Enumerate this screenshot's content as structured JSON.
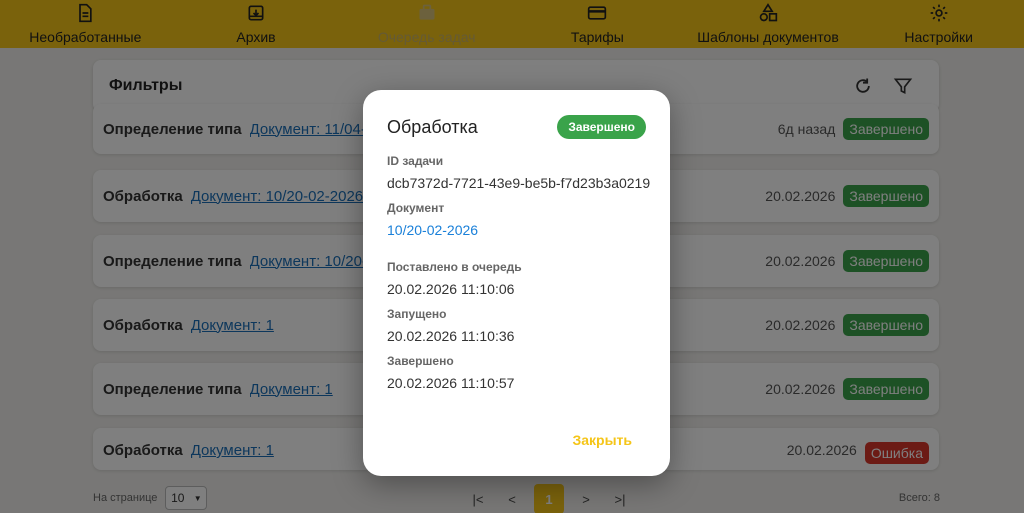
{
  "nav": {
    "items": [
      {
        "label": "Необработанные",
        "icon": "document-icon"
      },
      {
        "label": "Архив",
        "icon": "archive-icon"
      },
      {
        "label": "Очередь задач",
        "icon": "briefcase-icon"
      },
      {
        "label": "Тарифы",
        "icon": "credit-card-icon"
      },
      {
        "label": "Шаблоны документов",
        "icon": "shapes-icon"
      },
      {
        "label": "Настройки",
        "icon": "gear-icon"
      }
    ],
    "active_index": 2,
    "color": "#f5c518"
  },
  "filters": {
    "title": "Фильтры"
  },
  "rows": [
    {
      "type": "Определение типа",
      "doc": "Документ: 11/04-",
      "date": "6д назад",
      "status": "Завершено"
    },
    {
      "type": "Обработка",
      "doc": "Документ: 10/20-02-2026",
      "date": "20.02.2026",
      "status": "Завершено"
    },
    {
      "type": "Определение типа",
      "doc": "Документ: 10/20-",
      "date": "20.02.2026",
      "status": "Завершено"
    },
    {
      "type": "Обработка",
      "doc": "Документ: 1",
      "date": "20.02.2026",
      "status": "Завершено"
    },
    {
      "type": "Определение типа",
      "doc": "Документ: 1",
      "date": "20.02.2026",
      "status": "Завершено"
    },
    {
      "type": "Обработка",
      "doc": "Документ: 1",
      "date": "20.02.2026",
      "status": "Ошибка"
    }
  ],
  "pager": {
    "per_page_label": "На странице",
    "per_page_value": "10",
    "current_page": "1",
    "total": "Всего: 8"
  },
  "dialog": {
    "title": "Обработка",
    "badge": "Завершено",
    "task_id_label": "ID задачи",
    "task_id": "dcb7372d-7721-43e9-be5b-f7d23b3a0219",
    "document_label": "Документ",
    "document": "10/20-02-2026",
    "queued_label": "Поставлено в очередь",
    "queued": "20.02.2026 11:10:06",
    "started_label": "Запущено",
    "started": "20.02.2026 11:10:36",
    "finished_label": "Завершено",
    "finished": "20.02.2026 11:10:57",
    "close_label": "Закрыть"
  },
  "colors": {
    "accent": "#f5c518",
    "success": "#3aa34a",
    "error": "#d9362b",
    "link": "#1a6fb8"
  }
}
